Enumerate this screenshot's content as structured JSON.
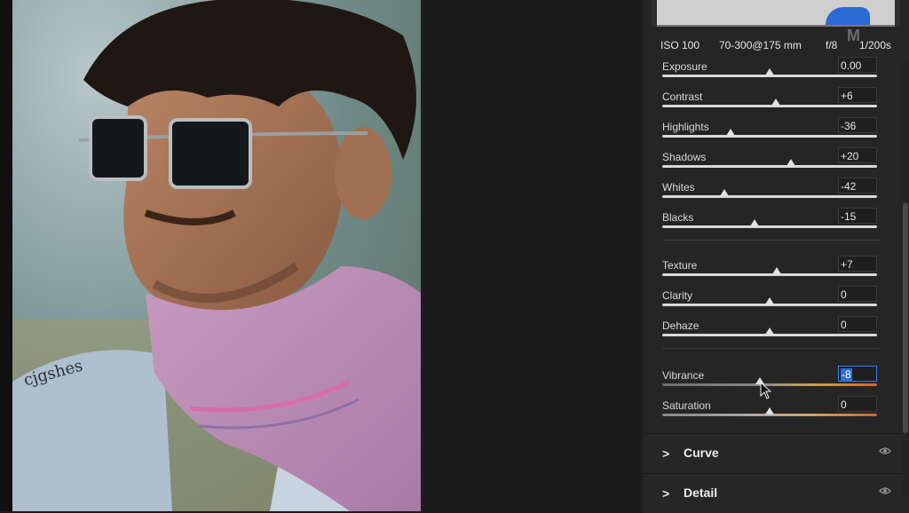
{
  "camera_info": {
    "iso": "ISO 100",
    "lens": "70-300@175 mm",
    "aperture": "f/8",
    "shutter": "1/200s"
  },
  "watermark_text": "M",
  "photo_overlay_text": "cjgshes",
  "sliders_group_1": [
    {
      "label": "Exposure",
      "value": "0.00",
      "position": 0.5
    },
    {
      "label": "Contrast",
      "value": "+6",
      "position": 0.53
    },
    {
      "label": "Highlights",
      "value": "-36",
      "position": 0.32
    },
    {
      "label": "Shadows",
      "value": "+20",
      "position": 0.6
    },
    {
      "label": "Whites",
      "value": "-42",
      "position": 0.29
    },
    {
      "label": "Blacks",
      "value": "-15",
      "position": 0.43
    }
  ],
  "sliders_group_2": [
    {
      "label": "Texture",
      "value": "+7",
      "position": 0.535
    },
    {
      "label": "Clarity",
      "value": "0",
      "position": 0.5
    },
    {
      "label": "Dehaze",
      "value": "0",
      "position": 0.5
    }
  ],
  "sliders_group_3": [
    {
      "label": "Vibrance",
      "value": "-8",
      "position": 0.455,
      "active": true
    },
    {
      "label": "Saturation",
      "value": "0",
      "position": 0.5
    }
  ],
  "sections": [
    {
      "title": "Curve",
      "chevron": ">"
    },
    {
      "title": "Detail",
      "chevron": ">"
    }
  ],
  "colors": {
    "accent": "#2f6fd8",
    "panel": "#252525"
  }
}
